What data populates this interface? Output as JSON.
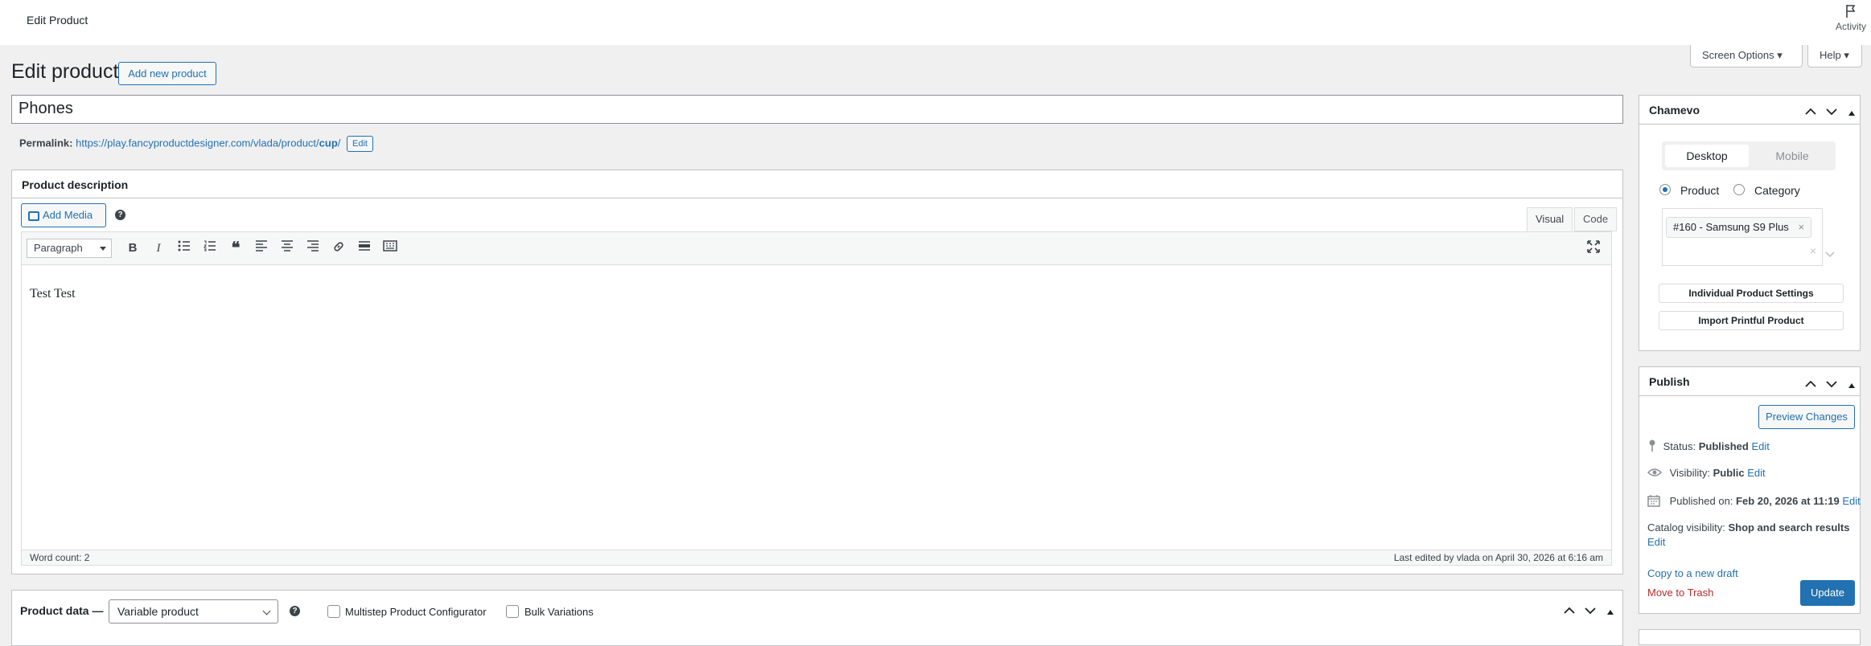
{
  "topbar": {
    "title": "Edit Product",
    "activity_label": "Activity"
  },
  "screen_options": {
    "screen_options_label": "Screen Options ▾",
    "help_label": "Help ▾"
  },
  "heading": {
    "title": "Edit product",
    "add_new_label": "Add new product"
  },
  "product": {
    "title": "Phones"
  },
  "permalink": {
    "label": "Permalink:",
    "url_prefix": "https://play.fancyproductdesigner.com/vlada/product/",
    "slug": "cup",
    "url_suffix": "/",
    "edit_label": "Edit"
  },
  "description": {
    "title": "Product description",
    "add_media_label": "Add Media",
    "help_glyph": "?",
    "tab_visual": "Visual",
    "tab_code": "Code",
    "format_select": "Paragraph",
    "toolbar_icons": [
      "bold-icon",
      "italic-icon",
      "bullet-list-icon",
      "numbered-list-icon",
      "blockquote-icon",
      "align-left-icon",
      "align-center-icon",
      "align-right-icon",
      "link-icon",
      "read-more-icon",
      "toolbar-toggle-icon"
    ],
    "content": "Test Test",
    "word_count": "Word count: 2",
    "last_edited": "Last edited by vlada on April 30, 2026 at 6:16 am"
  },
  "product_data": {
    "label": "Product data —",
    "type_selected": "Variable product",
    "multistep_label": "Multistep Product Configurator",
    "bulk_label": "Bulk Variations"
  },
  "chamevo": {
    "title": "Chamevo",
    "seg_desktop": "Desktop",
    "seg_mobile": "Mobile",
    "radio_product": "Product",
    "radio_category": "Category",
    "selected_chip": "#160 - Samsung S9 Plus",
    "chip_remove": "×",
    "clear_glyph": "×",
    "individual_settings_label": "Individual Product Settings",
    "import_printful_label": "Import Printful Product"
  },
  "publish": {
    "title": "Publish",
    "preview_label": "Preview Changes",
    "status_label": "Status:",
    "status_value": "Published",
    "visibility_label": "Visibility:",
    "visibility_value": "Public",
    "published_label": "Published on:",
    "published_value": "Feb 20, 2026 at 11:19",
    "catalog_label": "Catalog visibility:",
    "catalog_value": "Shop and search results",
    "edit_label": "Edit",
    "copy_draft_label": "Copy to a new draft",
    "trash_label": "Move to Trash",
    "update_label": "Update"
  },
  "colors": {
    "accent": "#2271b1",
    "danger": "#b32d2e",
    "background": "#f0f0f1"
  }
}
